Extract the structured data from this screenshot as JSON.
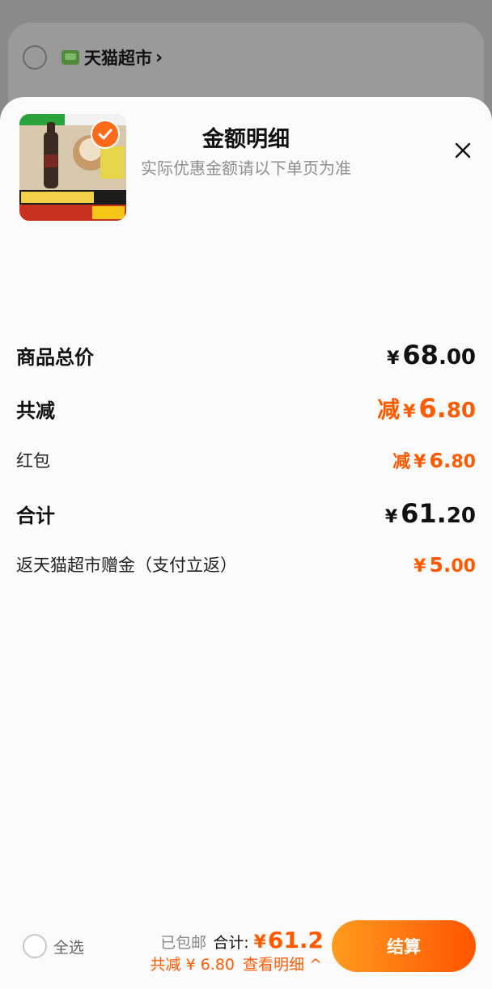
{
  "store": {
    "name": "天猫超市",
    "chevron": "›",
    "icon": "tmall-supermarket-logo-icon"
  },
  "sheet": {
    "title": "金额明细",
    "subtitle": "实际优惠金额请以下单页为准",
    "close_icon": "close-icon"
  },
  "product": {
    "image_icon": "product-thumbnail",
    "selected": true
  },
  "rows": {
    "subtotal": {
      "label": "商品总价",
      "yen": "¥",
      "int": "68",
      "dec": ".00"
    },
    "discount_total": {
      "label": "共减",
      "prefix": "减",
      "yen": "¥",
      "int": "6.",
      "dec": "80"
    },
    "red_packet": {
      "label": "红包",
      "prefix": "减",
      "yen": "¥",
      "int": "6.",
      "dec": "80"
    },
    "total": {
      "label": "合计",
      "yen": "¥",
      "int": "61.",
      "dec": "20"
    },
    "cashback": {
      "label": "返天猫超市赠金（支付立返）",
      "yen": "¥",
      "int": "5.",
      "dec": "00"
    }
  },
  "bottom_bar": {
    "select_all": "全选",
    "free_shipping": "已包邮",
    "total_label": "合计:",
    "total_yen": "¥",
    "total_amount": "61.2",
    "discount_line": "共减 ¥ 6.80",
    "view_detail": "查看明细 ^",
    "checkout": "结算"
  },
  "colors": {
    "accent": "#ff5a00",
    "button_gradient_start": "#ff9b1f",
    "button_gradient_end": "#ff5500"
  }
}
